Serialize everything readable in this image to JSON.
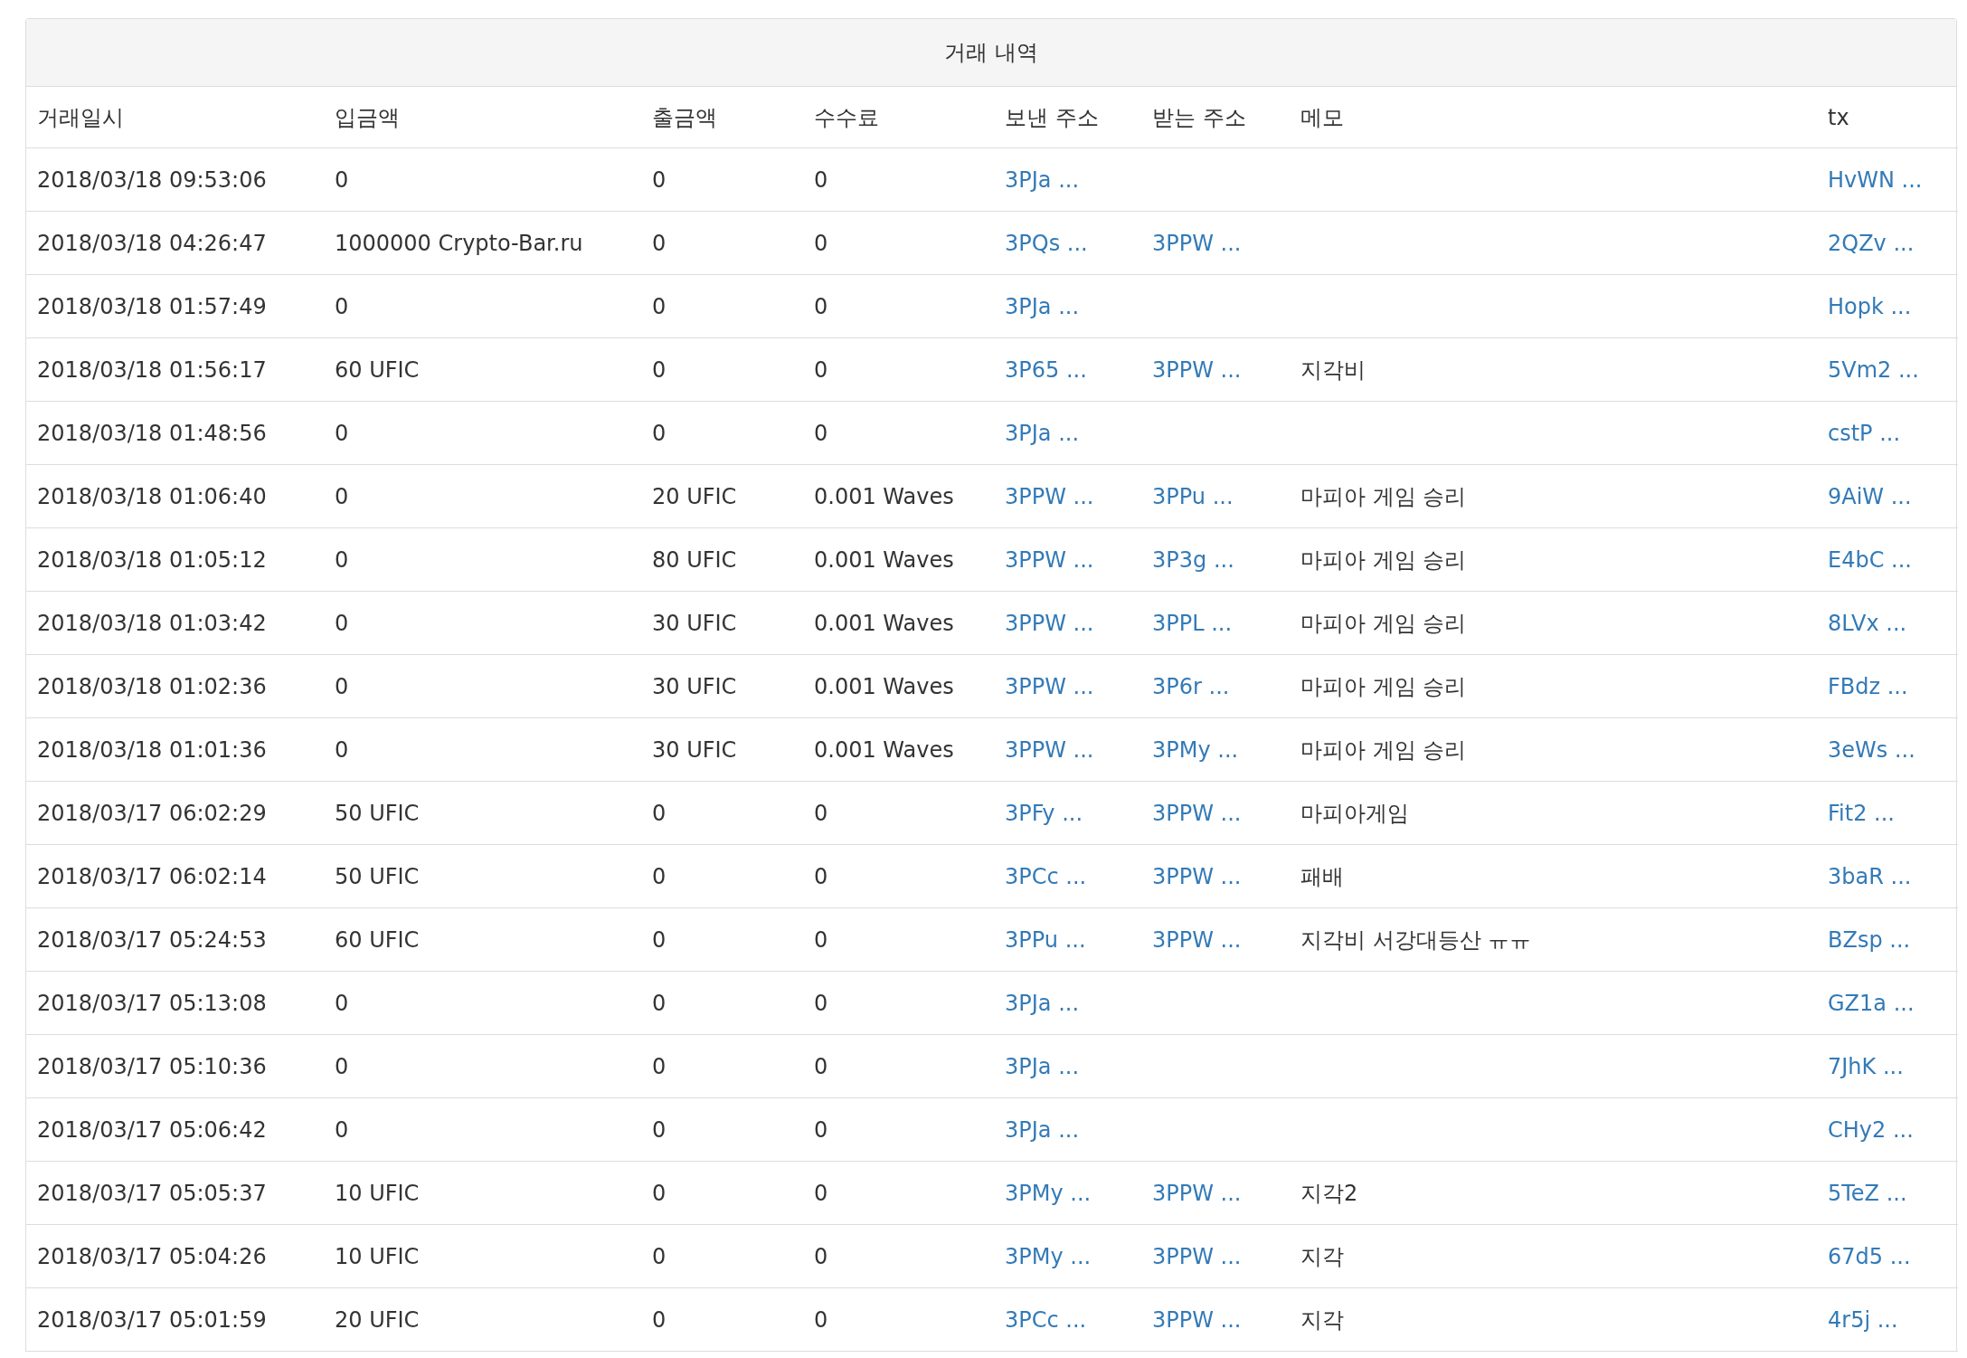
{
  "panel": {
    "title": "거래 내역"
  },
  "table": {
    "columns": [
      "거래일시",
      "입금액",
      "출금액",
      "수수료",
      "보낸 주소",
      "받는 주소",
      "메모",
      "tx"
    ],
    "rows": [
      {
        "date": "2018/03/18 09:53:06",
        "deposit": "0",
        "withdrawal": "0",
        "fee": "0",
        "from": "3PJa ...",
        "tx": "HvWN ..."
      },
      {
        "date": "2018/03/18 04:26:47",
        "deposit": "1000000 Crypto-Bar.ru",
        "withdrawal": "0",
        "fee": "0",
        "from": "3PQs ...",
        "to": "3PPW ...",
        "tx": "2QZv ..."
      },
      {
        "date": "2018/03/18 01:57:49",
        "deposit": "0",
        "withdrawal": "0",
        "fee": "0",
        "from": "3PJa ...",
        "tx": "Hopk ..."
      },
      {
        "date": "2018/03/18 01:56:17",
        "deposit": "60 UFIC",
        "withdrawal": "0",
        "fee": "0",
        "from": "3P65 ...",
        "to": "3PPW ...",
        "memo": "지각비",
        "tx": "5Vm2 ..."
      },
      {
        "date": "2018/03/18 01:48:56",
        "deposit": "0",
        "withdrawal": "0",
        "fee": "0",
        "from": "3PJa ...",
        "tx": "cstP ..."
      },
      {
        "date": "2018/03/18 01:06:40",
        "deposit": "0",
        "withdrawal": "20 UFIC",
        "fee": "0.001 Waves",
        "from": "3PPW ...",
        "to": "3PPu ...",
        "memo": "마피아 게임 승리",
        "tx": "9AiW ..."
      },
      {
        "date": "2018/03/18 01:05:12",
        "deposit": "0",
        "withdrawal": "80 UFIC",
        "fee": "0.001 Waves",
        "from": "3PPW ...",
        "to": "3P3g ...",
        "memo": "마피아 게임 승리",
        "tx": "E4bC ..."
      },
      {
        "date": "2018/03/18 01:03:42",
        "deposit": "0",
        "withdrawal": "30 UFIC",
        "fee": "0.001 Waves",
        "from": "3PPW ...",
        "to": "3PPL ...",
        "memo": "마피아 게임 승리",
        "tx": "8LVx ..."
      },
      {
        "date": "2018/03/18 01:02:36",
        "deposit": "0",
        "withdrawal": "30 UFIC",
        "fee": "0.001 Waves",
        "from": "3PPW ...",
        "to": "3P6r ...",
        "memo": "마피아 게임 승리",
        "tx": "FBdz ..."
      },
      {
        "date": "2018/03/18 01:01:36",
        "deposit": "0",
        "withdrawal": "30 UFIC",
        "fee": "0.001 Waves",
        "from": "3PPW ...",
        "to": "3PMy ...",
        "memo": "마피아 게임 승리",
        "tx": "3eWs ..."
      },
      {
        "date": "2018/03/17 06:02:29",
        "deposit": "50 UFIC",
        "withdrawal": "0",
        "fee": "0",
        "from": "3PFy ...",
        "to": "3PPW ...",
        "memo": "마피아게임",
        "tx": "Fit2 ..."
      },
      {
        "date": "2018/03/17 06:02:14",
        "deposit": "50 UFIC",
        "withdrawal": "0",
        "fee": "0",
        "from": "3PCc ...",
        "to": "3PPW ...",
        "memo": "패배",
        "tx": "3baR ..."
      },
      {
        "date": "2018/03/17 05:24:53",
        "deposit": "60 UFIC",
        "withdrawal": "0",
        "fee": "0",
        "from": "3PPu ...",
        "to": "3PPW ...",
        "memo": "지각비 서강대등산 ㅠㅠ",
        "tx": "BZsp ..."
      },
      {
        "date": "2018/03/17 05:13:08",
        "deposit": "0",
        "withdrawal": "0",
        "fee": "0",
        "from": "3PJa ...",
        "tx": "GZ1a ..."
      },
      {
        "date": "2018/03/17 05:10:36",
        "deposit": "0",
        "withdrawal": "0",
        "fee": "0",
        "from": "3PJa ...",
        "tx": "7JhK ..."
      },
      {
        "date": "2018/03/17 05:06:42",
        "deposit": "0",
        "withdrawal": "0",
        "fee": "0",
        "from": "3PJa ...",
        "tx": "CHy2 ..."
      },
      {
        "date": "2018/03/17 05:05:37",
        "deposit": "10 UFIC",
        "withdrawal": "0",
        "fee": "0",
        "from": "3PMy ...",
        "to": "3PPW ...",
        "memo": "지각2",
        "tx": "5TeZ ..."
      },
      {
        "date": "2018/03/17 05:04:26",
        "deposit": "10 UFIC",
        "withdrawal": "0",
        "fee": "0",
        "from": "3PMy ...",
        "to": "3PPW ...",
        "memo": "지각",
        "tx": "67d5 ..."
      },
      {
        "date": "2018/03/17 05:01:59",
        "deposit": "20 UFIC",
        "withdrawal": "0",
        "fee": "0",
        "from": "3PCc ...",
        "to": "3PPW ...",
        "memo": "지각",
        "tx": "4r5j ..."
      }
    ]
  }
}
